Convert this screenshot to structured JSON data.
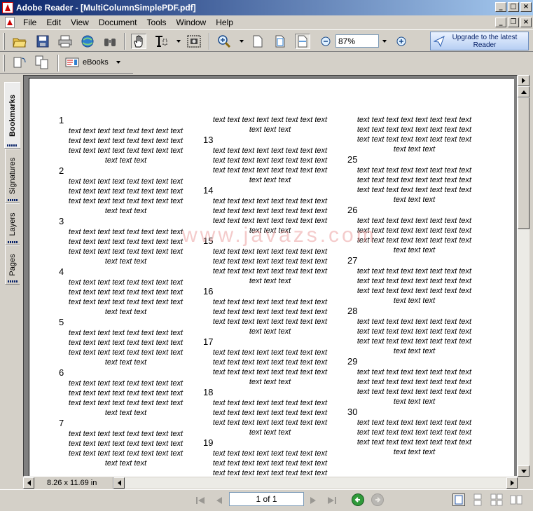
{
  "window": {
    "title": "Adobe Reader - [MultiColumnSimplePDF.pdf]"
  },
  "menu": {
    "items": [
      "File",
      "Edit",
      "View",
      "Document",
      "Tools",
      "Window",
      "Help"
    ]
  },
  "toolbar": {
    "zoom_value": "87%",
    "upgrade_label": "Upgrade to the latest Reader",
    "ebooks_label": "eBooks"
  },
  "side_tabs": [
    "Bookmarks",
    "Signatures",
    "Layers",
    "Pages"
  ],
  "document": {
    "word": "text",
    "line_full": "text text text text text text text text",
    "line_tail": "text text text",
    "watermark": "www.javazs.com",
    "columns": [
      {
        "lead_lines": 0,
        "sections": [
          "1",
          "2",
          "3",
          "4",
          "5",
          "6",
          "7"
        ]
      },
      {
        "lead_lines": 2,
        "sections": [
          "13",
          "14",
          "15",
          "16",
          "17",
          "18",
          "19"
        ]
      },
      {
        "lead_lines": 4,
        "sections": [
          "25",
          "26",
          "27",
          "28",
          "29",
          "30"
        ]
      }
    ]
  },
  "status": {
    "page_size": "8.26 x 11.69 in",
    "page_indicator": "1 of 1"
  }
}
